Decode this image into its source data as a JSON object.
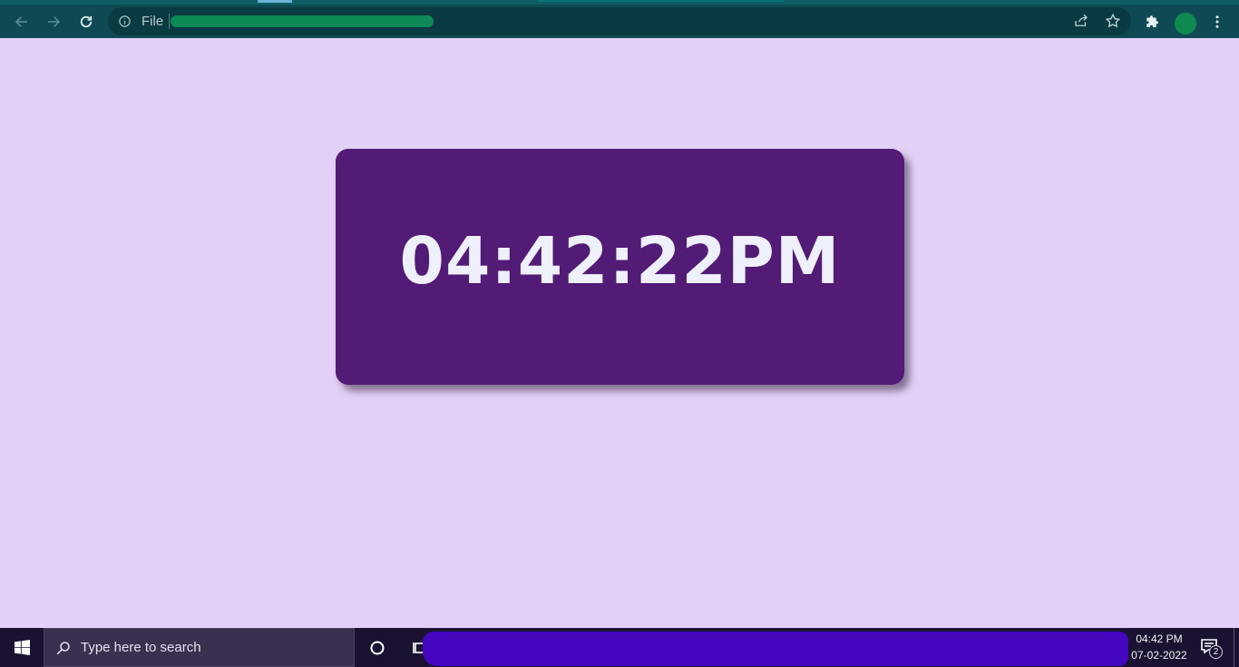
{
  "browser": {
    "address_prefix": "File",
    "icons": [
      "back-arrow-icon",
      "forward-arrow-icon",
      "reload-icon",
      "info-icon",
      "share-icon",
      "star-icon",
      "extensions-icon",
      "more-vert-icon"
    ]
  },
  "clock": {
    "time": "04:42:22PM"
  },
  "taskbar": {
    "search_placeholder": "Type here to search",
    "tray_time": "04:42 PM",
    "tray_date": "07-02-2022",
    "notification_count": "2"
  },
  "colors": {
    "page_background": "#e3d0f6",
    "clock_card": "#521b76",
    "clock_text": "#eef0fb",
    "browser_toolbar": "#0f4a54",
    "taskbar": "#1a1230"
  }
}
